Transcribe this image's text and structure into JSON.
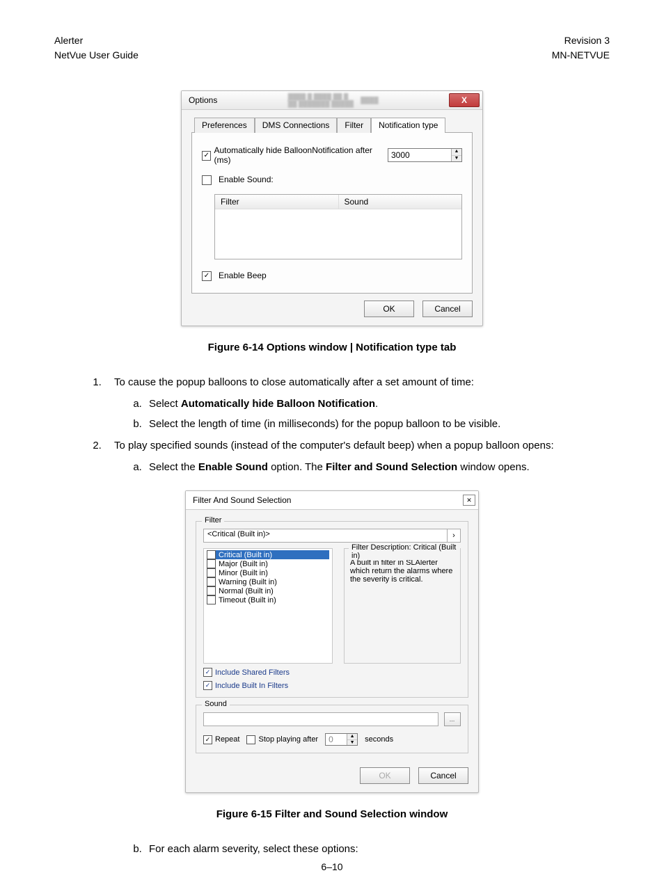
{
  "header": {
    "left1": "Alerter",
    "left2": "NetVue User Guide",
    "right1": "Revision 3",
    "right2": "MN-NETVUE"
  },
  "fig614_caption": "Figure 6-14 Options window | Notification type tab",
  "options_dialog": {
    "title": "Options",
    "tabs": {
      "t1": "Preferences",
      "t2": "DMS Connections",
      "t3": "Filter",
      "t4": "Notification type"
    },
    "auto_hide_label": "Automatically hide BalloonNotification after (ms)",
    "auto_hide_value": "3000",
    "enable_sound_label": "Enable Sound:",
    "col_filter": "Filter",
    "col_sound": "Sound",
    "enable_beep_label": "Enable Beep",
    "ok": "OK",
    "cancel": "Cancel"
  },
  "list": {
    "li1": "To cause the popup balloons to close automatically after a set amount of time:",
    "li1a_pre": "Select ",
    "li1a_bold": "Automatically hide Balloon Notification",
    "li1a_post": ".",
    "li1b": "Select the length of time (in milliseconds) for the popup balloon to be visible.",
    "li2": "To play specified sounds (instead of the computer's default beep) when a popup balloon opens:",
    "li2a_pre": "Select the ",
    "li2a_b1": "Enable Sound",
    "li2a_mid": " option. The ",
    "li2a_b2": "Filter and Sound Selection",
    "li2a_post": " window opens.",
    "li2b": "For each alarm severity, select these options:"
  },
  "filter_dialog": {
    "title": "Filter And Sound Selection",
    "fs_filter": "Filter",
    "drop_value": "<Critical (Built in)>",
    "items": {
      "i0": "Critical (Built in)",
      "i1": "Major (Built in)",
      "i2": "Minor (Built in)",
      "i3": "Warning (Built in)",
      "i4": "Normal (Built in)",
      "i5": "Timeout (Built in)"
    },
    "desc_title": "Filter Description: Critical (Built in)",
    "desc_body": "A built in filter in SLAlerter which return the alarms where the severity is critical.",
    "include_shared": "Include Shared Filters",
    "include_builtin": "Include Built In Filters",
    "fs_sound": "Sound",
    "repeat": "Repeat",
    "stop_after": "Stop playing after",
    "stop_value": "0",
    "seconds": "seconds",
    "ok": "OK",
    "cancel": "Cancel"
  },
  "fig615_caption": "Figure 6-15 Filter and Sound Selection window",
  "page_number": "6–10"
}
